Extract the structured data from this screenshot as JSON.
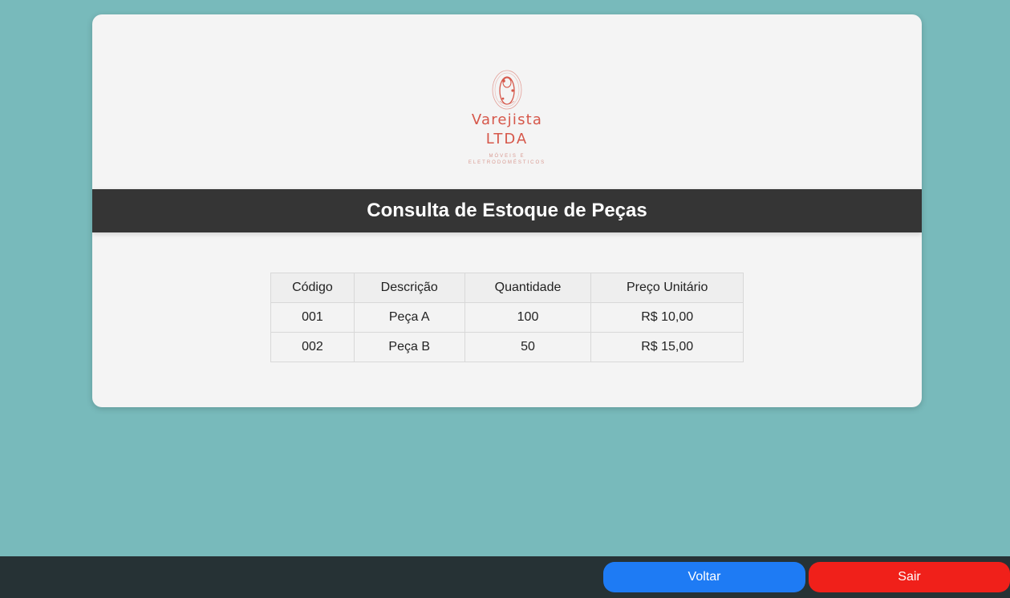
{
  "page": {
    "background_color": "#78babb"
  },
  "logo": {
    "icon": "ornament-logo-icon",
    "line1": "Varejista",
    "line2": "LTDA",
    "sub1": "MÓVEIS E",
    "sub2": "ELETRODOMÉSTICOS",
    "color": "#d6574a"
  },
  "header": {
    "title": "Consulta de Estoque de Peças",
    "background_color": "#353535"
  },
  "table": {
    "columns": [
      "Código",
      "Descrição",
      "Quantidade",
      "Preço Unitário"
    ],
    "rows": [
      [
        "001",
        "Peça A",
        "100",
        "R$ 10,00"
      ],
      [
        "002",
        "Peça B",
        "50",
        "R$ 15,00"
      ]
    ]
  },
  "footer": {
    "back_label": "Voltar",
    "exit_label": "Sair",
    "back_color": "#1e7bf4",
    "exit_color": "#f0201a"
  }
}
